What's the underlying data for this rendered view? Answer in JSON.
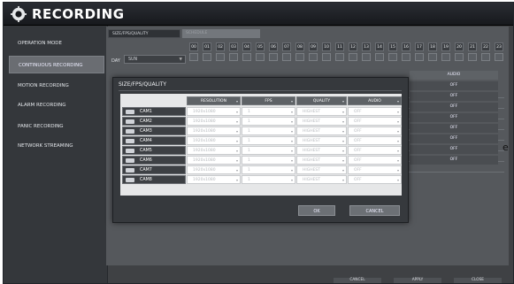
{
  "window": {
    "title": "RECORDING"
  },
  "sidebar": {
    "items": [
      {
        "label": "OPERATION MODE"
      },
      {
        "label": "CONTINUOUS RECORDING",
        "active": true
      },
      {
        "label": "MOTION RECORDING"
      },
      {
        "label": "ALARM RECORDING"
      },
      {
        "label": "PANIC RECORDING"
      },
      {
        "label": "NETWORK STREAMING"
      }
    ]
  },
  "tabs": [
    {
      "label": "SIZE/FPS/QUALITY",
      "active": true
    },
    {
      "label": "SCHEDULE",
      "active": false
    }
  ],
  "schedule": {
    "hours": [
      "00",
      "01",
      "02",
      "03",
      "04",
      "05",
      "06",
      "07",
      "08",
      "09",
      "10",
      "11",
      "12",
      "13",
      "14",
      "15",
      "16",
      "17",
      "18",
      "19",
      "20",
      "21",
      "22",
      "23"
    ],
    "day_label": "DAY",
    "day_value": "SUN"
  },
  "background_table": {
    "audio_header": "AUDIO",
    "audio_values": [
      "OFF",
      "OFF",
      "OFF",
      "OFF",
      "OFF",
      "OFF",
      "OFF",
      "OFF"
    ]
  },
  "footer": {
    "cancel_label": "CANCEL",
    "apply_label": "APPLY",
    "close_label": "CLOSE"
  },
  "modal": {
    "title": "SIZE/FPS/QUALITY",
    "headers": {
      "resolution": "RESOLUTION",
      "fps": "FPS",
      "quality": "QUALITY",
      "audio": "AUDIO"
    },
    "rows": [
      {
        "cam": "CAM1",
        "resolution": "1920x1080",
        "fps": "1",
        "quality": "HIGHEST",
        "audio": "OFF"
      },
      {
        "cam": "CAM2",
        "resolution": "1920x1080",
        "fps": "1",
        "quality": "HIGHEST",
        "audio": "OFF"
      },
      {
        "cam": "CAM3",
        "resolution": "1920x1080",
        "fps": "1",
        "quality": "HIGHEST",
        "audio": "OFF"
      },
      {
        "cam": "CAM4",
        "resolution": "1920x1080",
        "fps": "1",
        "quality": "HIGHEST",
        "audio": "OFF"
      },
      {
        "cam": "CAM5",
        "resolution": "1920x1080",
        "fps": "1",
        "quality": "HIGHEST",
        "audio": "OFF"
      },
      {
        "cam": "CAM6",
        "resolution": "1920x1080",
        "fps": "1",
        "quality": "HIGHEST",
        "audio": "OFF"
      },
      {
        "cam": "CAM7",
        "resolution": "1920x1080",
        "fps": "1",
        "quality": "HIGHEST",
        "audio": "OFF"
      },
      {
        "cam": "CAM8",
        "resolution": "1920x1080",
        "fps": "1",
        "quality": "HIGHEST",
        "audio": "OFF"
      }
    ],
    "ok_label": "OK",
    "cancel_label": "CANCEL"
  },
  "edge_text": "e"
}
